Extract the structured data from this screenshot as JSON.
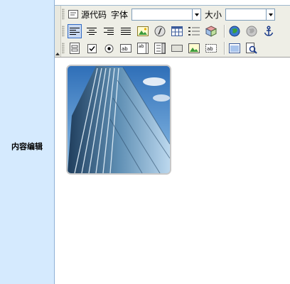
{
  "field": {
    "label": "内容编辑"
  },
  "toolbar": {
    "source_label": "源代码",
    "font_label": "字体",
    "font_value": "",
    "size_label": "大小",
    "size_value": ""
  },
  "content": {
    "image": "skyscraper photo"
  },
  "colors": {
    "label_bg": "#d5eafe",
    "toolbar_bg": "#eeeee6",
    "active_button": "#316ac5"
  }
}
